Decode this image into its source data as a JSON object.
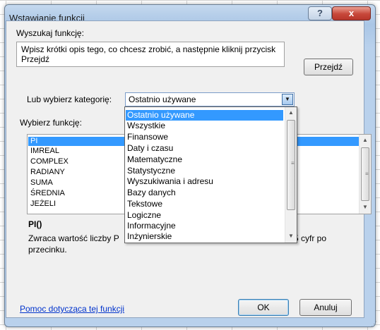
{
  "dialog": {
    "title": "Wstawianie funkcji",
    "help_button": "?",
    "close_button": "x"
  },
  "search": {
    "label": "Wyszukaj funkcję:",
    "value": "Wpisz krótki opis tego, co chcesz zrobić, a następnie kliknij przycisk Przejdź",
    "go_button": "Przejdź"
  },
  "category": {
    "label": "Lub wybierz kategorię:",
    "selected": "Ostatnio używane",
    "options": [
      "Ostatnio używane",
      "Wszystkie",
      "Finansowe",
      "Daty i czasu",
      "Matematyczne",
      "Statystyczne",
      "Wyszukiwania i adresu",
      "Bazy danych",
      "Tekstowe",
      "Logiczne",
      "Informacyjne",
      "Inżynierskie"
    ]
  },
  "functions": {
    "label": "Wybierz funkcję:",
    "items": [
      "PI",
      "IMREAL",
      "COMPLEX",
      "RADIANY",
      "SUMA",
      "ŚREDNIA",
      "JEŻELI"
    ],
    "selected": "PI"
  },
  "details": {
    "name": "PI()",
    "desc_start": "Zwraca wartość liczby P",
    "desc_end": "5 cyfr po",
    "desc_line2": "przecinku."
  },
  "footer": {
    "help_link": "Pomoc dotycząca tej funkcji",
    "ok": "OK",
    "cancel": "Anuluj"
  }
}
